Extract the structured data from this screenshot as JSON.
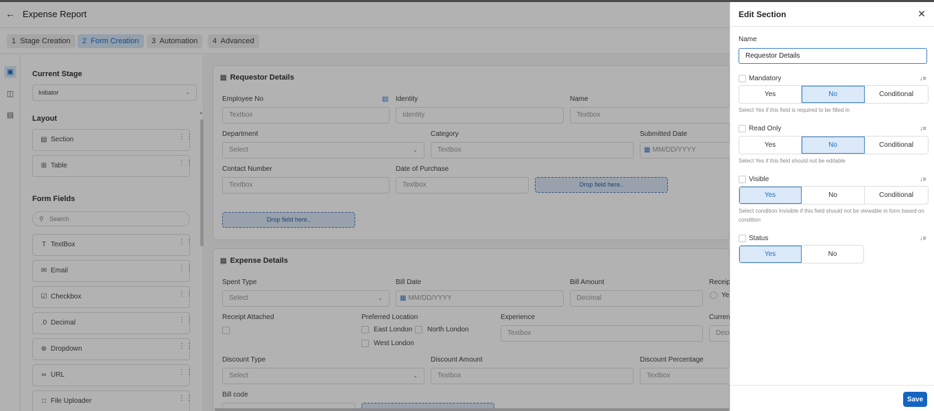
{
  "header": {
    "back_icon": "arrow-left-icon",
    "title": "Expense Report"
  },
  "tabs": [
    {
      "num": "1",
      "label": "Stage Creation"
    },
    {
      "num": "2",
      "label": "Form Creation"
    },
    {
      "num": "3",
      "label": "Automation"
    },
    {
      "num": "4",
      "label": "Advanced"
    }
  ],
  "rail": [
    "cube-icon",
    "form-icon",
    "archive-icon"
  ],
  "left": {
    "current_stage_label": "Current Stage",
    "current_stage_value": "Initiator",
    "layout_label": "Layout",
    "layout_items": [
      {
        "icon": "section-icon",
        "label": "Section"
      },
      {
        "icon": "table-icon",
        "label": "Table"
      }
    ],
    "form_fields_label": "Form Fields",
    "search_placeholder": "Search",
    "field_items": [
      {
        "icon": "text-icon",
        "label": "TextBox"
      },
      {
        "icon": "email-icon",
        "label": "Email"
      },
      {
        "icon": "checkbox-icon",
        "label": "Checkbox"
      },
      {
        "icon": "decimal-icon",
        "label": "Decimal"
      },
      {
        "icon": "dropdown-icon",
        "label": "Dropdown"
      },
      {
        "icon": "link-icon",
        "label": "URL"
      },
      {
        "icon": "file-icon",
        "label": "File Uploader"
      }
    ]
  },
  "canvas": {
    "requestor": {
      "title": "Requestor Details",
      "employee_no_label": "Employee No",
      "employee_no_ph": "Textbox",
      "identity_label": "Identity",
      "identity_ph": "Identity",
      "name_label": "Name",
      "name_ph": "Textbox",
      "department_label": "Department",
      "department_ph": "Select",
      "category_label": "Category",
      "category_ph": "Textbox",
      "submitted_date_label": "Submitted Date",
      "submitted_date_ph": "MM/DD/YYYY",
      "contact_label": "Contact Number",
      "contact_ph": "Textbox",
      "purchase_label": "Date of Purchase",
      "purchase_ph": "Textbox",
      "drop_text": "Drop field here..",
      "drop_text2": "Drop field here.."
    },
    "expense": {
      "title": "Expense Details",
      "spent_type_label": "Spent Type",
      "spent_type_ph": "Select",
      "bill_date_label": "Bill Date",
      "bill_date_ph": "MM/DD/YYYY",
      "bill_amount_label": "Bill Amount",
      "bill_amount_ph": "Decimal",
      "receipt_label_cut": "Receip",
      "receipt_radio_cut": "Ye",
      "receipt_attached_label": "Receipt Attached",
      "preferred_location_label": "Preferred Location",
      "locations": [
        "East London",
        "North London",
        "West London"
      ],
      "experience_label": "Experience",
      "experience_ph": "Textbox",
      "currency_label_cut": "Curren",
      "currency_ph_cut": "Deci",
      "discount_type_label": "Discount Type",
      "discount_type_ph": "Select",
      "discount_amount_label": "Discount Amount",
      "discount_amount_ph": "Textbox",
      "discount_pct_label": "Discount Percentage",
      "discount_pct_ph": "Textbox",
      "bill_code_label": "Bill code"
    }
  },
  "drawer": {
    "title": "Edit Section",
    "close_icon": "close-icon",
    "name_label": "Name",
    "name_value": "Requestor Details",
    "options": [
      {
        "label": "Mandatory",
        "buttons": [
          "Yes",
          "No",
          "Conditional"
        ],
        "selected": "No",
        "hint": "Select Yes if this field is required to be filled in"
      },
      {
        "label": "Read Only",
        "buttons": [
          "Yes",
          "No",
          "Conditional"
        ],
        "selected": "No",
        "hint": "Select Yes if this field should not be editable"
      },
      {
        "label": "Visible",
        "buttons": [
          "Yes",
          "No",
          "Conditional"
        ],
        "selected": "Yes",
        "hint": "Select condition Invisible if this field should not be viewable in form based on condition"
      },
      {
        "label": "Status",
        "buttons": [
          "Yes",
          "No"
        ],
        "selected": "Yes",
        "hint": ""
      }
    ],
    "save_label": "Save"
  }
}
